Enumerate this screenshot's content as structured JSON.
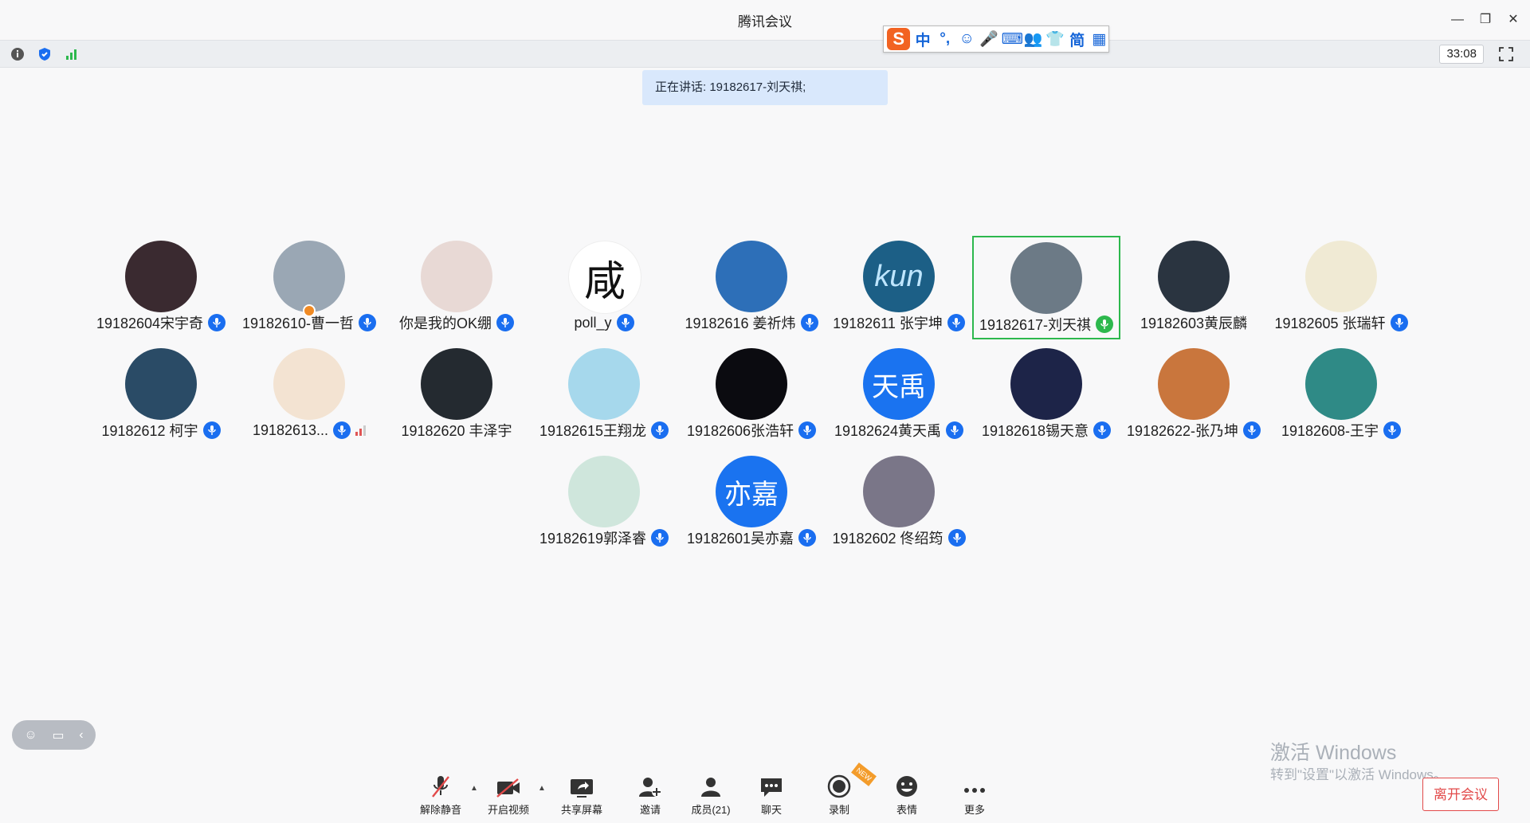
{
  "window": {
    "title": "腾讯会议",
    "minimize_icon": "minimize-icon",
    "restore_icon": "restore-icon",
    "close_icon": "close-icon"
  },
  "status": {
    "timer": "33:08"
  },
  "ime": {
    "logo": "S",
    "items": [
      "中",
      "°,",
      "☺",
      "🎤",
      "⌨",
      "👥",
      "👕",
      "简",
      "▦"
    ]
  },
  "speaking": {
    "text": "正在讲话: 19182617-刘天祺;"
  },
  "participants": [
    {
      "name": "19182604宋宇奇",
      "mic": "blue",
      "avatar_text": "",
      "avatar_color": "#3a2a30"
    },
    {
      "name": "19182610-曹一哲",
      "mic": "blue-on",
      "avatar_text": "",
      "avatar_color": "#9aa7b4",
      "host": true
    },
    {
      "name": "你是我的OK绷",
      "mic": "blue",
      "avatar_text": "",
      "avatar_color": "#e8d9d5"
    },
    {
      "name": "poll_y",
      "mic": "blue",
      "avatar_text": "咸",
      "avatar_color": "#ffffff",
      "avatar_text_color": "#111111"
    },
    {
      "name": "19182616 姜祈炜",
      "mic": "blue",
      "avatar_text": "",
      "avatar_color": "#2d6fb8"
    },
    {
      "name": "19182611 张宇坤",
      "mic": "blue",
      "avatar_text": "kun",
      "avatar_color": "#1c5f86"
    },
    {
      "name": "19182617-刘天祺",
      "mic": "green",
      "avatar_text": "",
      "avatar_color": "#6c7a86",
      "active": true
    },
    {
      "name": "19182603黄辰麟",
      "mic": "none",
      "avatar_text": "",
      "avatar_color": "#2a3440"
    },
    {
      "name": "19182605 张瑞轩",
      "mic": "blue",
      "avatar_text": "",
      "avatar_color": "#f0ead4"
    },
    {
      "name": "19182612 柯宇",
      "mic": "blue",
      "avatar_text": "",
      "avatar_color": "#2a4b66"
    },
    {
      "name": "19182613...",
      "mic": "blue",
      "avatar_text": "",
      "avatar_color": "#f3e3d2",
      "signal": true
    },
    {
      "name": "19182620  丰泽宇",
      "mic": "none",
      "avatar_text": "",
      "avatar_color": "#242a30"
    },
    {
      "name": "19182615王翔龙",
      "mic": "blue",
      "avatar_text": "",
      "avatar_color": "#a6d8ec"
    },
    {
      "name": "19182606张浩轩",
      "mic": "blue",
      "avatar_text": "",
      "avatar_color": "#0b0b10"
    },
    {
      "name": "19182624黄天禹",
      "mic": "blue",
      "avatar_text": "天禹",
      "avatar_color": "#1a73f0"
    },
    {
      "name": "19182618锡天意",
      "mic": "blue",
      "avatar_text": "",
      "avatar_color": "#1d2448"
    },
    {
      "name": "19182622-张乃坤",
      "mic": "blue",
      "avatar_text": "",
      "avatar_color": "#c9763d"
    },
    {
      "name": "19182608-王宇",
      "mic": "blue",
      "avatar_text": "",
      "avatar_color": "#2f8a86"
    },
    {
      "name": "19182619郭泽睿",
      "mic": "blue",
      "avatar_text": "",
      "avatar_color": "#cfe6dc"
    },
    {
      "name": "19182601吴亦嘉",
      "mic": "blue-on",
      "avatar_text": "亦嘉",
      "avatar_color": "#1a73f0"
    },
    {
      "name": "19182602 佟绍筠",
      "mic": "blue",
      "avatar_text": "",
      "avatar_color": "#7a7688"
    }
  ],
  "watermark": {
    "line1": "激活 Windows",
    "line2": "转到\"设置\"以激活 Windows。"
  },
  "toolbar": {
    "unmute": "解除静音",
    "video": "开启视频",
    "share": "共享屏幕",
    "invite": "邀请",
    "members": "成员(21)",
    "chat": "聊天",
    "record": "录制",
    "record_tag": "NEW",
    "emoji": "表情",
    "more": "更多",
    "leave": "离开会议"
  },
  "colors": {
    "accent": "#1a6ef0",
    "speaking": "#2db84d",
    "leave": "#e24a4a"
  }
}
